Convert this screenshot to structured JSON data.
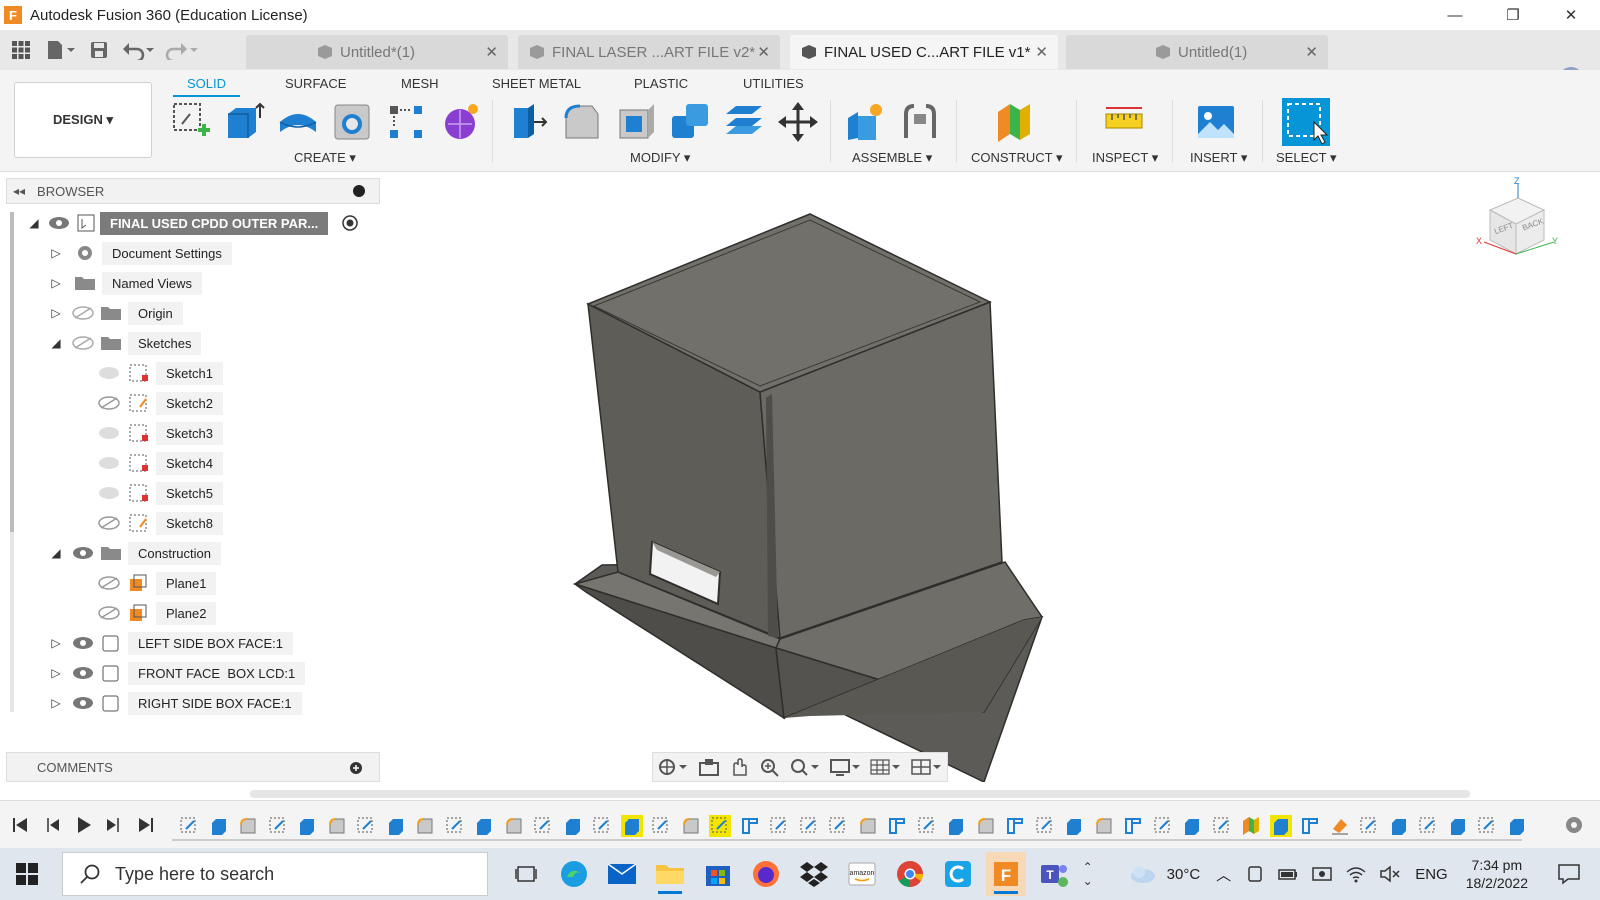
{
  "window": {
    "title": "Autodesk Fusion 360 (Education License)",
    "minimize": "—",
    "restore": "❐",
    "close": "✕"
  },
  "tabs": [
    {
      "label": "Untitled*(1)",
      "active": false
    },
    {
      "label": "FINAL LASER ...ART FILE v2*",
      "active": false
    },
    {
      "label": "FINAL USED C...ART FILE v1*",
      "active": true
    },
    {
      "label": "Untitled(1)",
      "active": false
    }
  ],
  "ribbon": {
    "tabs": [
      "SOLID",
      "SURFACE",
      "MESH",
      "SHEET METAL",
      "PLASTIC",
      "UTILITIES"
    ],
    "active_tab": "SOLID",
    "workspace": "DESIGN ▾",
    "groups": {
      "create": "CREATE ▾",
      "modify": "MODIFY ▾",
      "assemble": "ASSEMBLE ▾",
      "construct": "CONSTRUCT ▾",
      "inspect": "INSPECT ▾",
      "insert": "INSERT ▾",
      "select": "SELECT ▾"
    }
  },
  "browser": {
    "header": "BROWSER",
    "root": "FINAL USED CPDD OUTER PAR...",
    "items": [
      {
        "label": "Document Settings"
      },
      {
        "label": "Named Views"
      },
      {
        "label": "Origin"
      },
      {
        "label": "Sketches"
      },
      {
        "label": "Sketch1"
      },
      {
        "label": "Sketch2"
      },
      {
        "label": "Sketch3"
      },
      {
        "label": "Sketch4"
      },
      {
        "label": "Sketch5"
      },
      {
        "label": "Sketch8"
      },
      {
        "label": "Construction"
      },
      {
        "label": "Plane1"
      },
      {
        "label": "Plane2"
      },
      {
        "label": "LEFT SIDE BOX FACE:1"
      },
      {
        "label": "FRONT FACE  BOX LCD:1"
      },
      {
        "label": "RIGHT SIDE BOX FACE:1"
      }
    ]
  },
  "comments": {
    "header": "COMMENTS"
  },
  "viewcube": {
    "face_front": "LEFT",
    "face_back": "BACK",
    "axis_x": "X",
    "axis_y": "Y",
    "axis_z": "Z"
  },
  "taskbar": {
    "search_placeholder": "Type here to search",
    "weather": "30°C",
    "language": "ENG",
    "time": "7:34 pm",
    "date": "18/2/2022"
  },
  "colors": {
    "accent": "#0696d7",
    "body_fill": "#6e6c67",
    "body_edge": "#2f2e2b",
    "highlight": "#f2e600"
  }
}
